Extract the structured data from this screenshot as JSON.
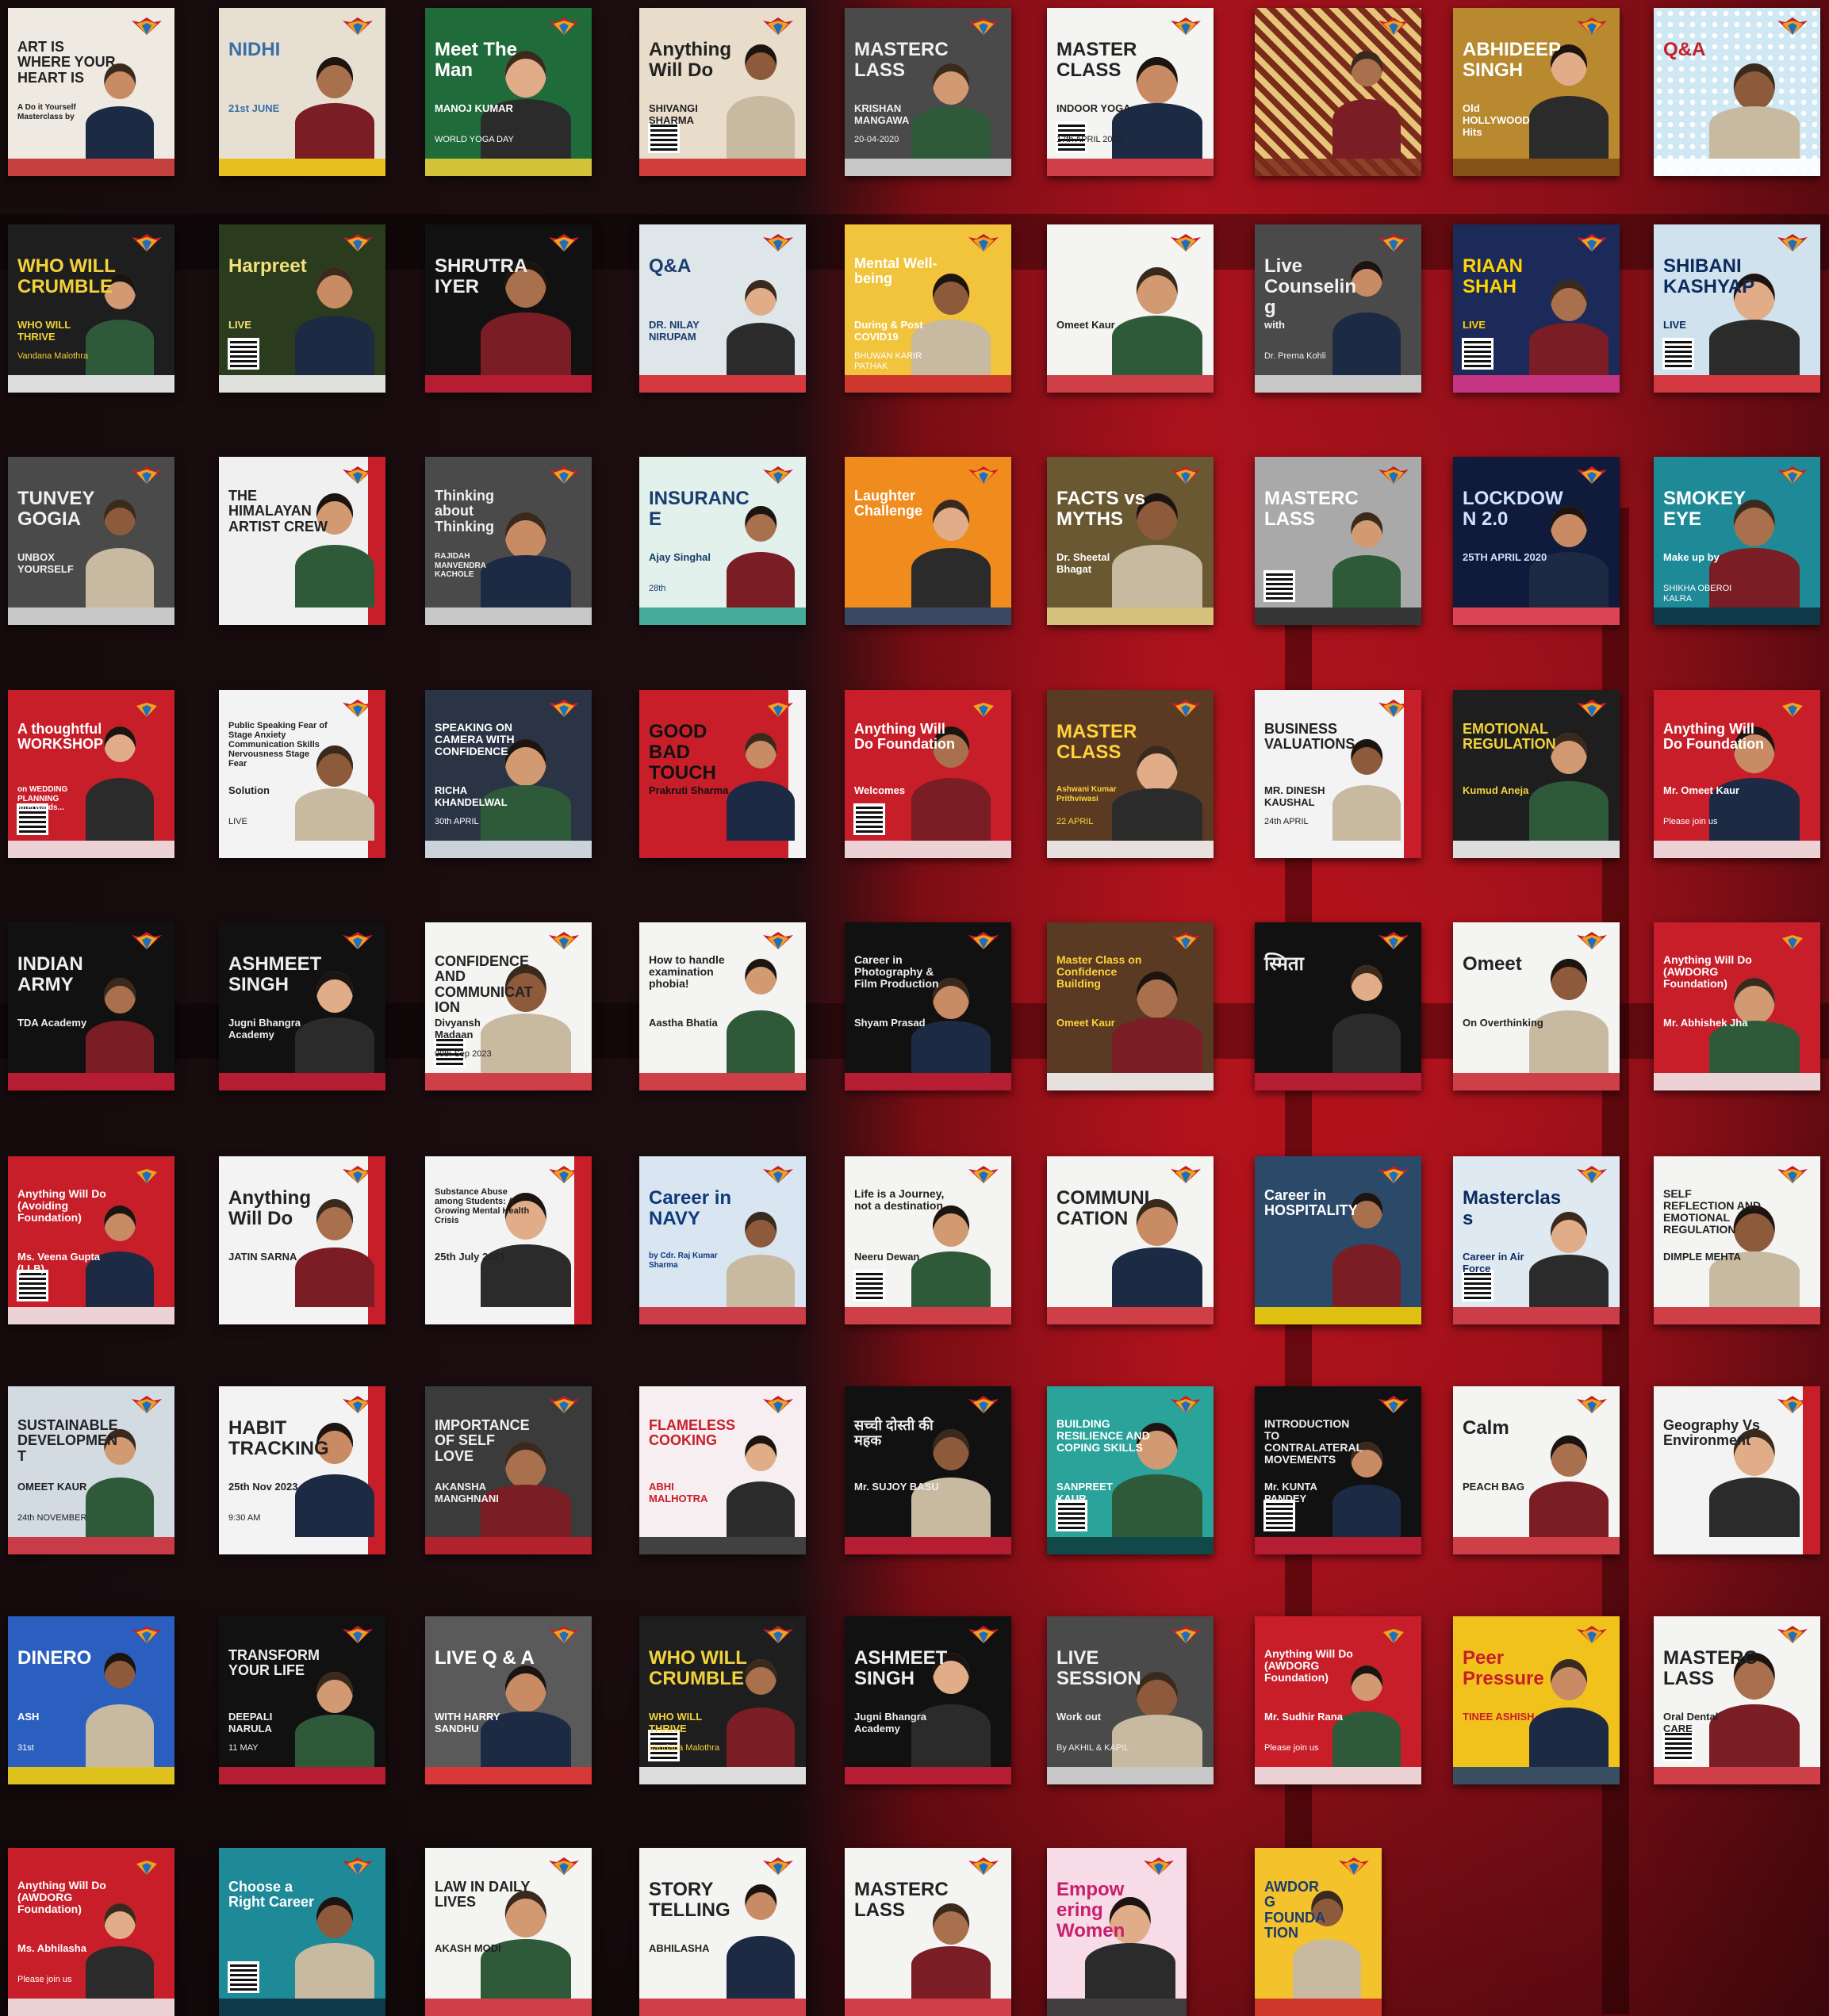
{
  "tiles": [
    {
      "text": "ART IS WHERE YOUR HEART IS",
      "sub": "A Do it Yourself Masterclass by",
      "sub2": "",
      "theme": "paper"
    },
    {
      "text": "NIDHI",
      "sub": "21st JUNE",
      "sub2": "",
      "theme": "yoga"
    },
    {
      "text": "Meet The Man",
      "sub": "MANOJ KUMAR",
      "sub2": "WORLD YOGA DAY",
      "theme": "green"
    },
    {
      "text": "Anything Will Do",
      "sub": "SHIVANGI SHARMA",
      "sub2": "",
      "theme": "tan"
    },
    {
      "text": "MASTERCLASS",
      "sub": "KRISHAN MANGAWA",
      "sub2": "20-04-2020",
      "theme": "mono"
    },
    {
      "text": "MASTER CLASS",
      "sub": "INDOOR YOGA",
      "sub2": "17th APRIL 2020",
      "theme": "white"
    },
    {
      "text": "",
      "sub": "",
      "sub2": "",
      "theme": "pattern"
    },
    {
      "text": "ABHIDEEP SINGH",
      "sub": "Old HOLLYWOOD Hits",
      "sub2": "",
      "theme": "amber"
    },
    {
      "text": "Q&A",
      "sub": "",
      "sub2": "",
      "theme": "dots"
    },
    {
      "text": "WHO WILL CRUMBLE",
      "sub": "WHO WILL THRIVE",
      "sub2": "Vandana Malothra",
      "theme": "dark"
    },
    {
      "text": "Harpreet",
      "sub": "LIVE",
      "sub2": "",
      "theme": "forest"
    },
    {
      "text": "SHRUTRA IYER",
      "sub": "",
      "sub2": "",
      "theme": "black"
    },
    {
      "text": "Q&A",
      "sub": "DR. NILAY NIRUPAM",
      "sub2": "",
      "theme": "clinic"
    },
    {
      "text": "Mental Well-being",
      "sub": "During & Post COVID19",
      "sub2": "BHUWAN KARIR PATHAK",
      "theme": "sun"
    },
    {
      "text": "",
      "sub": "Omeet Kaur",
      "sub2": "",
      "theme": "white"
    },
    {
      "text": "Live Counseling",
      "sub": "with",
      "sub2": "Dr. Prerna Kohli",
      "theme": "mono"
    },
    {
      "text": "RIAAN SHAH",
      "sub": "LIVE",
      "sub2": "",
      "theme": "neon"
    },
    {
      "text": "SHIBANI KASHYAP",
      "sub": "LIVE",
      "sub2": "",
      "theme": "lightblue"
    },
    {
      "text": "TUNVEY GOGIA",
      "sub": "UNBOX YOURSELF",
      "sub2": "",
      "theme": "mono"
    },
    {
      "text": "THE HIMALAYAN ARTIST CREW",
      "sub": "",
      "sub2": "",
      "theme": "redwhite"
    },
    {
      "text": "Thinking about Thinking",
      "sub": "RAJIDAH MANVENDRA KACHOLE",
      "sub2": "",
      "theme": "mono"
    },
    {
      "text": "INSURANCE",
      "sub": "Ajay Singhal",
      "sub2": "28th",
      "theme": "mint"
    },
    {
      "text": "Laughter Challenge",
      "sub": "",
      "sub2": "",
      "theme": "orange"
    },
    {
      "text": "FACTS vs MYTHS",
      "sub": "Dr. Sheetal Bhagat",
      "sub2": "",
      "theme": "olive"
    },
    {
      "text": "MASTERCLASS",
      "sub": "",
      "sub2": "",
      "theme": "gray"
    },
    {
      "text": "LOCKDOWN 2.0",
      "sub": "25TH APRIL 2020",
      "sub2": "",
      "theme": "night"
    },
    {
      "text": "SMOKEY EYE",
      "sub": "Make up by",
      "sub2": "SHIKHA OBEROI KALRA",
      "theme": "teal"
    },
    {
      "text": "A thoughtful WORKSHOP",
      "sub": "on WEDDING PLANNING afterwards...",
      "sub2": "",
      "theme": "red"
    },
    {
      "text": "Public Speaking Fear of Stage Anxiety Communication Skills Nervousness Stage Fear",
      "sub": "Solution",
      "sub2": "LIVE",
      "theme": "whitered"
    },
    {
      "text": "SPEAKING ON CAMERA WITH CONFIDENCE",
      "sub": "RICHA KHANDELWAL",
      "sub2": "30th APRIL",
      "theme": "slate"
    },
    {
      "text": "GOOD BAD TOUCH",
      "sub": "Prakruti Sharma",
      "sub2": "",
      "theme": "redblack"
    },
    {
      "text": "Anything Will Do Foundation",
      "sub": "Welcomes",
      "sub2": "",
      "theme": "red"
    },
    {
      "text": "MASTER CLASS",
      "sub": "Ashwani Kumar Prithviwasi",
      "sub2": "22 APRIL",
      "theme": "brown"
    },
    {
      "text": "BUSINESS VALUATIONS",
      "sub": "MR. DINESH KAUSHAL",
      "sub2": "24th APRIL",
      "theme": "whitered"
    },
    {
      "text": "EMOTIONAL REGULATION",
      "sub": "Kumud Aneja",
      "sub2": "",
      "theme": "dark"
    },
    {
      "text": "Anything Will Do Foundation",
      "sub": "Mr. Omeet Kaur",
      "sub2": "Please join us",
      "theme": "red"
    },
    {
      "text": "INDIAN ARMY",
      "sub": "TDA Academy",
      "sub2": "",
      "theme": "black"
    },
    {
      "text": "ASHMEET SINGH",
      "sub": "Jugni Bhangra Academy",
      "sub2": "",
      "theme": "black"
    },
    {
      "text": "CONFIDENCE AND COMMUNICATION",
      "sub": "Divyansh Madaan",
      "sub2": "09th Sep 2023",
      "theme": "white"
    },
    {
      "text": "How to handle examination phobia!",
      "sub": "Aastha Bhatia",
      "sub2": "",
      "theme": "white"
    },
    {
      "text": "Career in Photography & Film Production",
      "sub": "Shyam Prasad",
      "sub2": "",
      "theme": "black"
    },
    {
      "text": "Master Class on Confidence Building",
      "sub": "Omeet Kaur",
      "sub2": "",
      "theme": "brown"
    },
    {
      "text": "स्मिता",
      "sub": "",
      "sub2": "",
      "theme": "black"
    },
    {
      "text": "Omeet",
      "sub": "On Overthinking",
      "sub2": "",
      "theme": "white"
    },
    {
      "text": "Anything Will Do (AWDORG Foundation)",
      "sub": "Mr. Abhishek Jha",
      "sub2": "",
      "theme": "red"
    },
    {
      "text": "Anything Will Do (Avoiding Foundation)",
      "sub": "Ms. Veena Gupta (LLB)",
      "sub2": "",
      "theme": "red"
    },
    {
      "text": "Anything Will Do",
      "sub": "JATIN SARNA",
      "sub2": "",
      "theme": "whitered"
    },
    {
      "text": "Substance Abuse among Students: A Growing Mental Health Crisis",
      "sub": "25th July 2023",
      "sub2": "",
      "theme": "whitered"
    },
    {
      "text": "Career in NAVY",
      "sub": "by Cdr. Raj Kumar Sharma",
      "sub2": "",
      "theme": "navy"
    },
    {
      "text": "Life is a Journey, not a destination",
      "sub": "Neeru Dewan",
      "sub2": "",
      "theme": "white"
    },
    {
      "text": "COMMUNICATION",
      "sub": "",
      "sub2": "",
      "theme": "white"
    },
    {
      "text": "Career in HOSPITALITY",
      "sub": "",
      "sub2": "",
      "theme": "steel"
    },
    {
      "text": "Masterclass",
      "sub": "Career in Air Force",
      "sub2": "",
      "theme": "sky"
    },
    {
      "text": "SELF REFLECTION AND EMOTIONAL REGULATION",
      "sub": "DIMPLE MEHTA",
      "sub2": "",
      "theme": "white"
    },
    {
      "text": "SUSTAINABLE DEVELOPMENT",
      "sub": "OMEET KAUR",
      "sub2": "24th NOVEMBER",
      "theme": "grayblue"
    },
    {
      "text": "HABIT TRACKING",
      "sub": "25th Nov 2023",
      "sub2": "9:30 AM",
      "theme": "whitered"
    },
    {
      "text": "IMPORTANCE OF SELF LOVE",
      "sub": "AKANSHA MANGHNANI",
      "sub2": "",
      "theme": "chalk"
    },
    {
      "text": "FLAMELESS COOKING",
      "sub": "ABHI MALHOTRA",
      "sub2": "",
      "theme": "pinkwhite"
    },
    {
      "text": "सच्ची दोस्ती की महक",
      "sub": "Mr. SUJOY BASU",
      "sub2": "",
      "theme": "black"
    },
    {
      "text": "BUILDING RESILIENCE AND COPING SKILLS",
      "sub": "SANPREET KAUR",
      "sub2": "",
      "theme": "teal2"
    },
    {
      "text": "INTRODUCTION TO CONTRALATERAL MOVEMENTS",
      "sub": "Mr. KUNTA PANDEY",
      "sub2": "",
      "theme": "black"
    },
    {
      "text": "Calm",
      "sub": "PEACH BAG",
      "sub2": "",
      "theme": "white"
    },
    {
      "text": "Geography Vs Environment",
      "sub": "",
      "sub2": "",
      "theme": "whitered"
    },
    {
      "text": "DINERO",
      "sub": "ASH",
      "sub2": "31st",
      "theme": "blue"
    },
    {
      "text": "TRANSFORM YOUR LIFE",
      "sub": "DEEPALI NARULA",
      "sub2": "11 MAY",
      "theme": "black"
    },
    {
      "text": "LIVE Q & A",
      "sub": "WITH HARRY SANDHU",
      "sub2": "",
      "theme": "gym"
    },
    {
      "text": "WHO WILL CRUMBLE",
      "sub": "WHO WILL THRIVE",
      "sub2": "Vandana Malothra",
      "theme": "dark"
    },
    {
      "text": "ASHMEET SINGH",
      "sub": "Jugni Bhangra Academy",
      "sub2": "",
      "theme": "black"
    },
    {
      "text": "LIVE SESSION",
      "sub": "Work out",
      "sub2": "By AKHIL & KAPIL",
      "theme": "mono"
    },
    {
      "text": "Anything Will Do (AWDORG Foundation)",
      "sub": "Mr. Sudhir Rana",
      "sub2": "Please join us",
      "theme": "red"
    },
    {
      "text": "Peer Pressure",
      "sub": "TINEE ASHISH",
      "sub2": "",
      "theme": "yellow"
    },
    {
      "text": "MASTERCLASS",
      "sub": "Oral Dental CARE",
      "sub2": "",
      "theme": "white"
    },
    {
      "text": "Anything Will Do (AWDORG Foundation)",
      "sub": "Ms. Abhilasha",
      "sub2": "Please join us",
      "theme": "red"
    },
    {
      "text": "Choose a Right Career",
      "sub": "",
      "sub2": "",
      "theme": "teal"
    },
    {
      "text": "LAW IN DAILY LIVES",
      "sub": "AKASH MODI",
      "sub2": "",
      "theme": "white"
    },
    {
      "text": "STORY TELLING",
      "sub": "ABHILASHA",
      "sub2": "",
      "theme": "white"
    },
    {
      "text": "MASTERCLASS",
      "sub": "",
      "sub2": "",
      "theme": "white"
    },
    {
      "text": "Empowering Women",
      "sub": "",
      "sub2": "",
      "theme": "pink"
    },
    {
      "text": "AWDORG FOUNDATION",
      "sub": "",
      "sub2": "",
      "theme": "multi"
    }
  ]
}
